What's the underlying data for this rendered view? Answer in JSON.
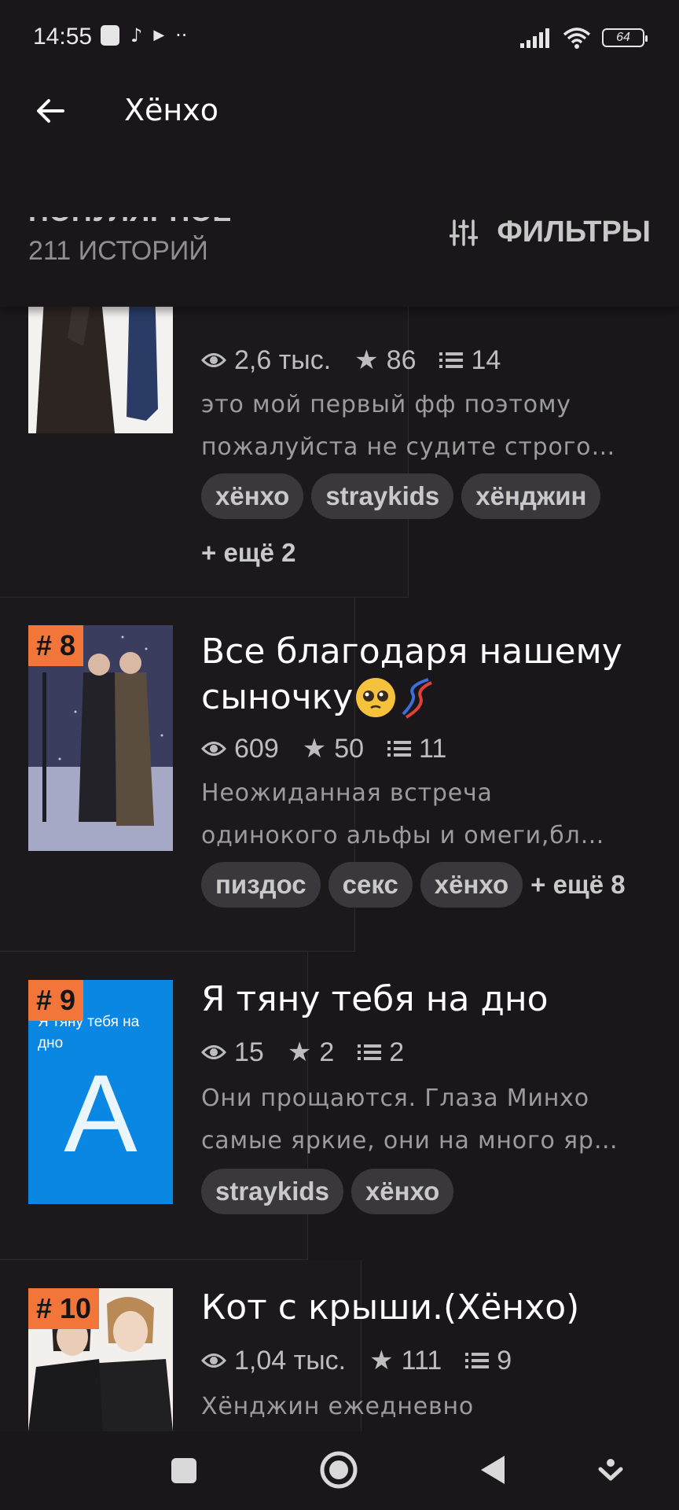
{
  "status_bar": {
    "time": "14:55",
    "battery": "64"
  },
  "app_bar": {
    "title": "Хёнхо"
  },
  "section": {
    "title": "ПОПУЛЯРНОЕ",
    "count": "211 ИСТОРИЙ",
    "filters_label": "ФИЛЬТРЫ"
  },
  "stories": [
    {
      "views": "2,6 тыс.",
      "stars": "86",
      "chapters": "14",
      "desc_line1": "это мой первый фф поэтому",
      "desc_line2": "пожалуйста не судите строго…",
      "tags": [
        "хёнхо",
        "straykids",
        "хёнджин"
      ],
      "more": "+ ещё 2"
    },
    {
      "rank": "# 8",
      "title_line1": "Все благодаря нашему",
      "title_line2": "сыночку",
      "views": "609",
      "stars": "50",
      "chapters": "11",
      "desc_line1": "Неожиданная встреча",
      "desc_line2": "одинокого альфы и омеги,бл…",
      "tags": [
        "пиздос",
        "секс",
        "хёнхо"
      ],
      "more": "+ ещё 8"
    },
    {
      "rank": "# 9",
      "cover_text": "Я тяну тебя на дно",
      "cover_letter": "A",
      "title_line1": "Я тяну тебя на дно",
      "views": "15",
      "stars": "2",
      "chapters": "2",
      "desc_line1": "Они прощаются. Глаза Минхо",
      "desc_line2": "самые яркие, они на много яр…",
      "tags": [
        "straykids",
        "хёнхо"
      ]
    },
    {
      "rank": "# 10",
      "title_line1": "Кот с крыши.(Хёнхо)",
      "views": "1,04 тыс.",
      "stars": "111",
      "chapters": "9",
      "desc_line1": "Хёнджин ежедневно"
    }
  ]
}
